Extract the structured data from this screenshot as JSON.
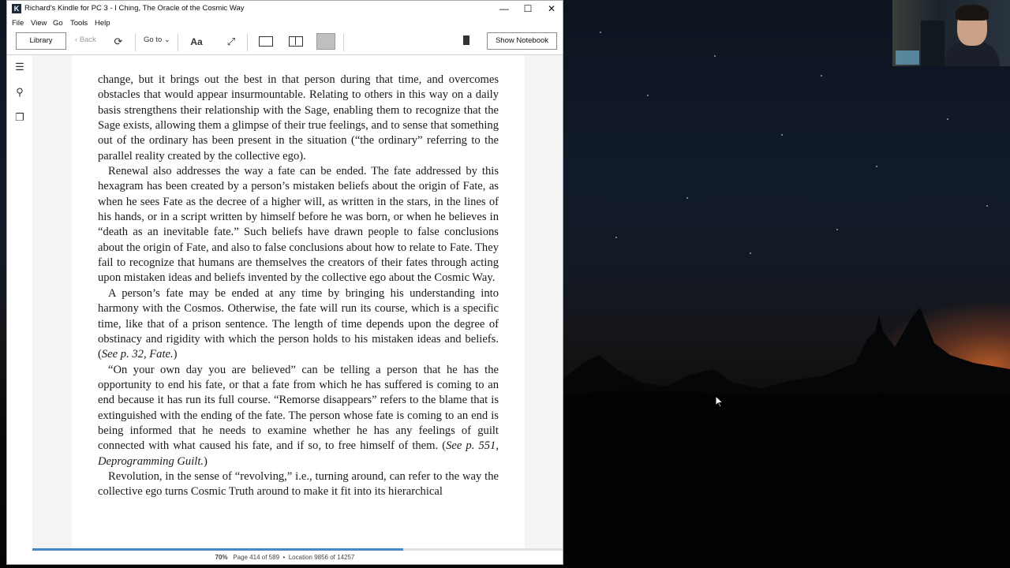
{
  "window": {
    "title": "Richard's Kindle for PC 3 - I Ching, The Oracle of the Cosmic Way",
    "logo_letter": "K",
    "controls": {
      "minimize": "—",
      "maximize": "☐",
      "close": "✕"
    }
  },
  "menu": [
    "File",
    "View",
    "Go",
    "Tools",
    "Help"
  ],
  "toolbar": {
    "library_label": "Library",
    "back_label": "Back",
    "goto_label": "Go to",
    "font_label": "Aa",
    "notebook_label": "Show Notebook"
  },
  "book": {
    "paragraphs": [
      "change, but it brings out the best in that person during that time, and overcomes obstacles that would appear insurmountable. Relating to others in this way on a daily basis strengthens their relationship with the Sage, enabling them to recognize that the Sage exists, allowing them a glimpse of their true feelings, and to sense that something out of the ordinary has been present in the situation (“the ordinary” referring to the parallel reality created by the collective ego).",
      "Renewal also addresses the way a fate can be ended. The fate addressed by this hexagram has been created by a person’s mistaken beliefs about the origin of Fate, as when he sees Fate as the decree of a higher will, as written in the stars, in the lines of his hands, or in a script written by himself before he was born, or when he believes in “death as an inevitable fate.” Such beliefs have drawn people to false conclusions about the origin of Fate, and also to false conclusions about how to relate to Fate. They fail to recognize that humans are themselves the creators of their fates through acting upon mistaken ideas and beliefs invented by the collective ego about the Cosmic Way.",
      "A person’s fate may be ended at any time by bringing his understanding into harmony with the Cosmos. Otherwise, the fate will run its course, which is a specific time, like that of a prison sentence. The length of time depends upon the degree of obstinacy and rigidity with which the person holds to his mistaken ideas and beliefs. (",
      "“On your own day you are believed” can be telling a person that he has the opportunity to end his fate, or that a fate from which he has suffered is coming to an end because it has run its full course. “Remorse disappears” refers to the blame that is extinguished with the ending of the fate. The person whose fate is coming to an end is being informed that he needs to examine whether he has any feelings of guilt connected with what caused his fate, and if so, to free himself of them. (",
      "Revolution, in the sense of “revolving,” i.e., turning around, can refer to the way the collective ego turns Cosmic Truth around to make it fit into its hierarchical"
    ],
    "ref1": "See p. 32, Fate.",
    "ref1_close": ")",
    "ref2": "See p. 551, Deprogramming Guilt.",
    "ref2_close": ")"
  },
  "status": {
    "percent_label": "70%",
    "page_label": "Page 414 of 589",
    "separator": "•",
    "location_label": "Location 9856 of 14257",
    "progress_fraction": 0.7
  },
  "colors": {
    "progress": "#4a86c5",
    "page": "#ffffff",
    "margin": "#f4f4f4"
  }
}
